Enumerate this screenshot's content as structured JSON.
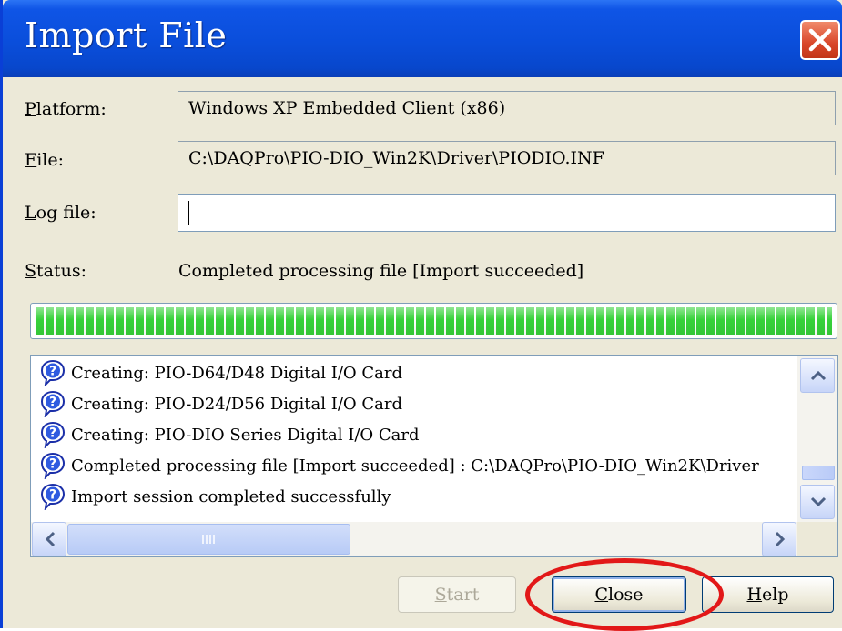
{
  "window": {
    "title": "Import File"
  },
  "fields": {
    "platform": {
      "label": "Platform:",
      "mnemonic": "P",
      "rest": "latform:",
      "value": "Windows XP Embedded Client (x86)"
    },
    "file": {
      "label": "File:",
      "mnemonic": "F",
      "rest": "ile:",
      "value": "C:\\DAQPro\\PIO-DIO_Win2K\\Driver\\PIODIO.INF"
    },
    "log_file": {
      "label": "Log file:",
      "mnemonic": "L",
      "rest": "og file:",
      "value": ""
    },
    "status": {
      "label": "Status:",
      "mnemonic": "S",
      "rest": "tatus:",
      "value": "Completed processing file [Import succeeded]"
    }
  },
  "progress": {
    "percent": 100,
    "color": "#37d23a"
  },
  "log": {
    "entries": [
      {
        "icon": "question-icon",
        "text": "Creating: PIO-D64/D48 Digital I/O Card"
      },
      {
        "icon": "question-icon",
        "text": "Creating: PIO-D24/D56 Digital I/O Card"
      },
      {
        "icon": "question-icon",
        "text": "Creating: PIO-DIO Series Digital I/O Card"
      },
      {
        "icon": "question-icon",
        "text": "Completed processing file [Import succeeded]  : C:\\DAQPro\\PIO-DIO_Win2K\\Driver"
      },
      {
        "icon": "question-icon",
        "text": "Import session completed successfully"
      }
    ]
  },
  "buttons": {
    "start": {
      "mnemonic": "S",
      "rest": "tart",
      "disabled": true
    },
    "close": {
      "mnemonic": "C",
      "rest": "lose",
      "focused": true
    },
    "help": {
      "mnemonic": "H",
      "rest": "elp"
    }
  },
  "colors": {
    "titlebar": "#0a4edb",
    "dialog_bg": "#ece9d8",
    "close_x": "#d9472a",
    "annotation_ring": "#e21818"
  }
}
